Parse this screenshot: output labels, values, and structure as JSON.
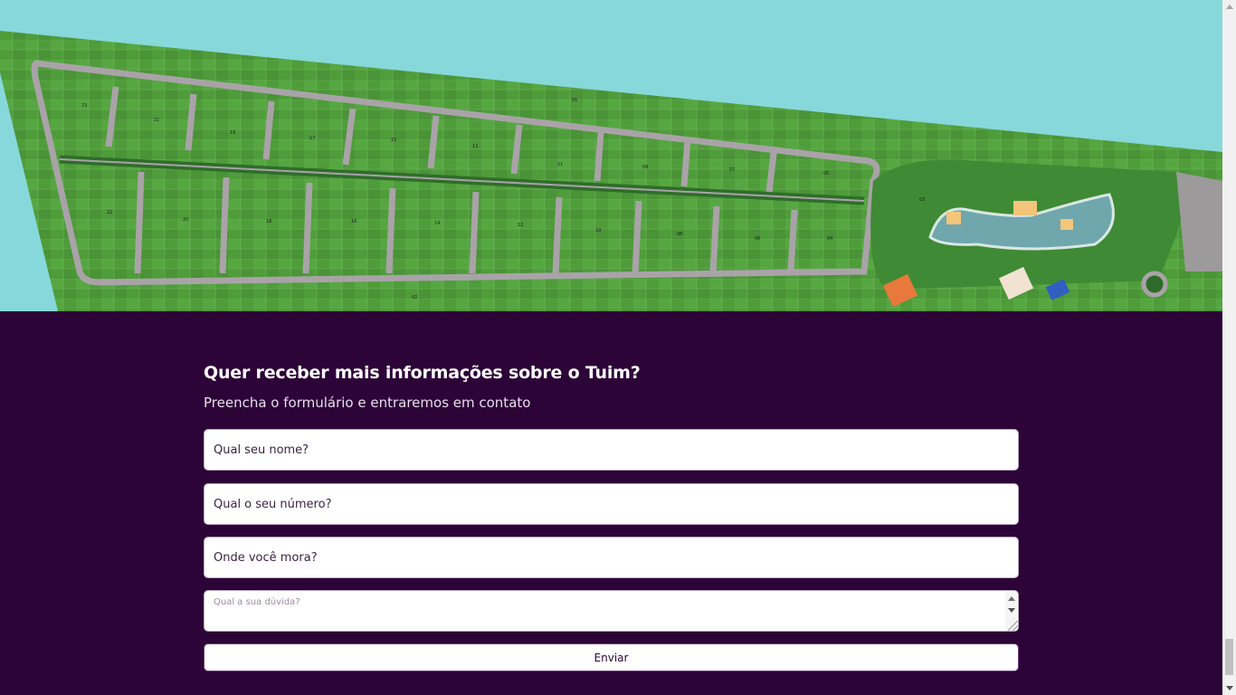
{
  "map": {
    "label": "Masterplan aerial map",
    "lot_numbers": [
      "23",
      "21",
      "19",
      "17",
      "15",
      "13",
      "11",
      "09",
      "07",
      "05",
      "22",
      "20",
      "18",
      "16",
      "14",
      "12",
      "10",
      "08",
      "06",
      "04",
      "03",
      "02",
      "01"
    ]
  },
  "contact": {
    "title": "Quer receber mais informações sobre o Tuim?",
    "subtitle": "Preencha o formulário e entraremos em contato",
    "name_placeholder": "Qual seu nome?",
    "phone_placeholder": "Qual o seu número?",
    "city_placeholder": "Onde você mora?",
    "question_placeholder": "Qual a sua dúvida?",
    "submit_label": "Enviar"
  },
  "colors": {
    "background": "#2d0437",
    "sky": "#87d8da",
    "grass": "#4e9a3a",
    "road": "#a9a3a8"
  }
}
